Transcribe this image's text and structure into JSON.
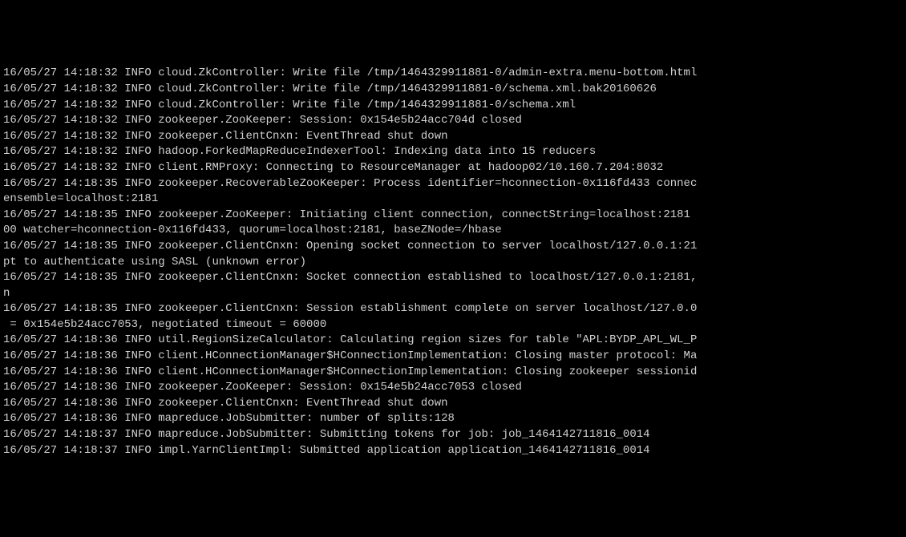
{
  "lines": [
    "16/05/27 14:18:32 INFO cloud.ZkController: Write file /tmp/1464329911881-0/admin-extra.menu-bottom.html",
    "16/05/27 14:18:32 INFO cloud.ZkController: Write file /tmp/1464329911881-0/schema.xml.bak20160626",
    "16/05/27 14:18:32 INFO cloud.ZkController: Write file /tmp/1464329911881-0/schema.xml",
    "16/05/27 14:18:32 INFO zookeeper.ZooKeeper: Session: 0x154e5b24acc704d closed",
    "16/05/27 14:18:32 INFO zookeeper.ClientCnxn: EventThread shut down",
    "16/05/27 14:18:32 INFO hadoop.ForkedMapReduceIndexerTool: Indexing data into 15 reducers",
    "16/05/27 14:18:32 INFO client.RMProxy: Connecting to ResourceManager at hadoop02/10.160.7.204:8032",
    "16/05/27 14:18:35 INFO zookeeper.RecoverableZooKeeper: Process identifier=hconnection-0x116fd433 connec",
    "ensemble=localhost:2181",
    "16/05/27 14:18:35 INFO zookeeper.ZooKeeper: Initiating client connection, connectString=localhost:2181 ",
    "00 watcher=hconnection-0x116fd433, quorum=localhost:2181, baseZNode=/hbase",
    "16/05/27 14:18:35 INFO zookeeper.ClientCnxn: Opening socket connection to server localhost/127.0.0.1:21",
    "pt to authenticate using SASL (unknown error)",
    "16/05/27 14:18:35 INFO zookeeper.ClientCnxn: Socket connection established to localhost/127.0.0.1:2181,",
    "n",
    "16/05/27 14:18:35 INFO zookeeper.ClientCnxn: Session establishment complete on server localhost/127.0.0",
    " = 0x154e5b24acc7053, negotiated timeout = 60000",
    "16/05/27 14:18:36 INFO util.RegionSizeCalculator: Calculating region sizes for table \"APL:BYDP_APL_WL_P",
    "16/05/27 14:18:36 INFO client.HConnectionManager$HConnectionImplementation: Closing master protocol: Ma",
    "16/05/27 14:18:36 INFO client.HConnectionManager$HConnectionImplementation: Closing zookeeper sessionid",
    "16/05/27 14:18:36 INFO zookeeper.ZooKeeper: Session: 0x154e5b24acc7053 closed",
    "16/05/27 14:18:36 INFO zookeeper.ClientCnxn: EventThread shut down",
    "16/05/27 14:18:36 INFO mapreduce.JobSubmitter: number of splits:128",
    "16/05/27 14:18:37 INFO mapreduce.JobSubmitter: Submitting tokens for job: job_1464142711816_0014",
    "16/05/27 14:18:37 INFO impl.YarnClientImpl: Submitted application application_1464142711816_0014"
  ]
}
